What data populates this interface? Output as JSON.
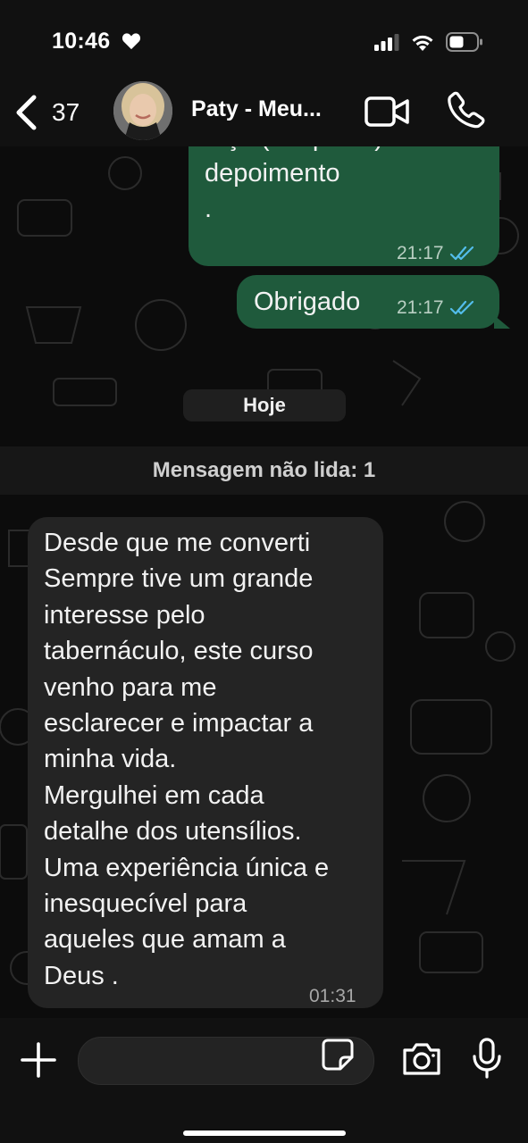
{
  "status_bar": {
    "time": "10:46"
  },
  "header": {
    "back_count": "37",
    "contact_name": "Paty - Meu..."
  },
  "chat": {
    "outgoing": [
      {
        "lines": [
          "faça (se quiser) um",
          "depoimento",
          "."
        ],
        "time": "21:17"
      },
      {
        "lines": [
          "Obrigado"
        ],
        "time": "21:17"
      }
    ],
    "date_separator": "Hoje",
    "unread_label": "Mensagem não lida: 1",
    "incoming": {
      "lines": [
        "Desde que me converti",
        "Sempre tive um grande",
        "interesse pelo",
        "tabernáculo, este curso",
        "venho para me",
        "esclarecer e impactar a",
        "minha vida.",
        "Mergulhei em cada",
        "detalhe dos utensílios.",
        "Uma experiência única e",
        "inesquecível para",
        "aqueles que amam a",
        "Deus ."
      ],
      "time": "01:31"
    }
  },
  "composer": {
    "value": ""
  },
  "icons": {
    "back": "chevron-left-icon",
    "video": "video-camera-icon",
    "call": "phone-icon",
    "plus": "plus-icon",
    "sticker": "sticker-icon",
    "camera": "camera-icon",
    "mic": "microphone-icon",
    "read_receipt": "double-check-icon"
  },
  "colors": {
    "outgoing_bubble": "#1f5a3c",
    "incoming_bubble": "#242424",
    "read_tick": "#53bdeb"
  }
}
